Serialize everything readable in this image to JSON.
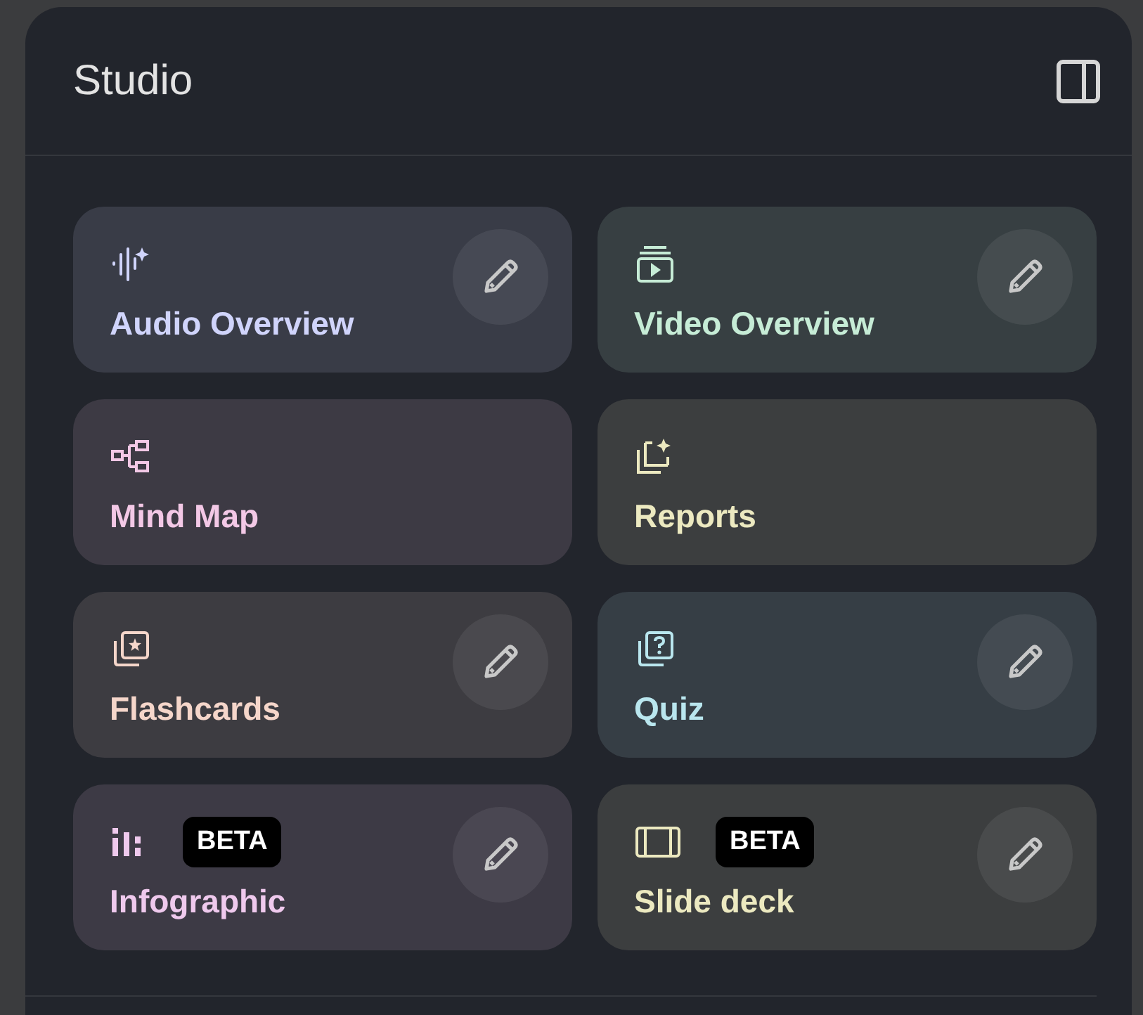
{
  "panel": {
    "title": "Studio"
  },
  "tiles": [
    {
      "label": "Audio Overview",
      "color": "#d0d4fb",
      "editable": true
    },
    {
      "label": "Video Overview",
      "color": "#c6ecd6",
      "editable": true
    },
    {
      "label": "Mind Map",
      "color": "#f3c8e6",
      "editable": false
    },
    {
      "label": "Reports",
      "color": "#ece9c0",
      "editable": false
    },
    {
      "label": "Flashcards",
      "color": "#f5d6ca",
      "editable": true
    },
    {
      "label": "Quiz",
      "color": "#b9e6ee",
      "editable": true
    },
    {
      "label": "Infographic",
      "color": "#efc9ed",
      "editable": true,
      "badge": "BETA"
    },
    {
      "label": "Slide deck",
      "color": "#ece9c0",
      "editable": true,
      "badge": "BETA"
    }
  ]
}
